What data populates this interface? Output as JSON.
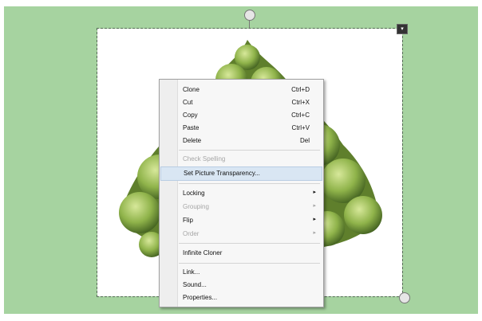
{
  "colors": {
    "background": "#a6d3a0",
    "highlight_ellipse": "#2f9a3a",
    "menu_highlight": "#d9e6f3"
  },
  "icons": {
    "rotate_handle": "rotate-handle-icon",
    "resize_handle": "resize-handle-icon",
    "frame_menu": "frame-menu-icon"
  },
  "context_menu": {
    "items": [
      {
        "label": "Clone",
        "shortcut": "Ctrl+D"
      },
      {
        "label": "Cut",
        "shortcut": "Ctrl+X"
      },
      {
        "label": "Copy",
        "shortcut": "Ctrl+C"
      },
      {
        "label": "Paste",
        "shortcut": "Ctrl+V"
      },
      {
        "label": "Delete",
        "shortcut": "Del"
      },
      {
        "label": "Check Spelling"
      },
      {
        "label": "Set Picture Transparency..."
      },
      {
        "label": "Locking"
      },
      {
        "label": "Grouping"
      },
      {
        "label": "Flip"
      },
      {
        "label": "Order"
      },
      {
        "label": "Infinite Cloner"
      },
      {
        "label": "Link..."
      },
      {
        "label": "Sound..."
      },
      {
        "label": "Properties..."
      }
    ]
  }
}
